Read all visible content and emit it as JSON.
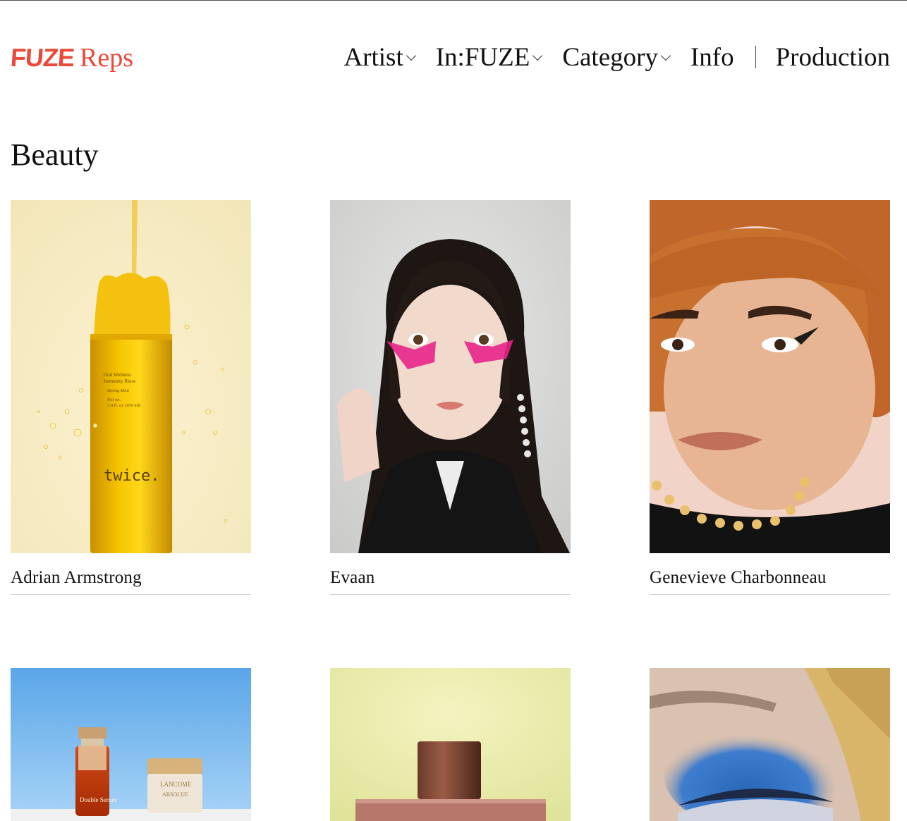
{
  "brand": {
    "logo_primary": "FUZE",
    "logo_secondary": "Reps",
    "color": "#ea4a3a"
  },
  "nav": {
    "items": [
      {
        "label": "Artist",
        "dropdown": true
      },
      {
        "label": "In:FUZE",
        "dropdown": true
      },
      {
        "label": "Category",
        "dropdown": true
      },
      {
        "label": "Info",
        "dropdown": false
      },
      {
        "label": "Production",
        "dropdown": false
      }
    ]
  },
  "page": {
    "title": "Beauty"
  },
  "artists": [
    {
      "name": "Adrian Armstrong"
    },
    {
      "name": "Evaan"
    },
    {
      "name": "Genevieve Charbonneau"
    }
  ],
  "product_text": {
    "bottle_brand": "twice.",
    "bottle_line1": "Oral Wellness",
    "bottle_line2": "Immunity Rinse",
    "bottle_line3": "Strong Mint",
    "bottle_line4": "Net wt.",
    "bottle_line5": "3.4 fl. oz (100 ml)",
    "serum_label": "Double Serum",
    "jar_brand": "LANCOME",
    "jar_label": "ABSOLUE"
  }
}
